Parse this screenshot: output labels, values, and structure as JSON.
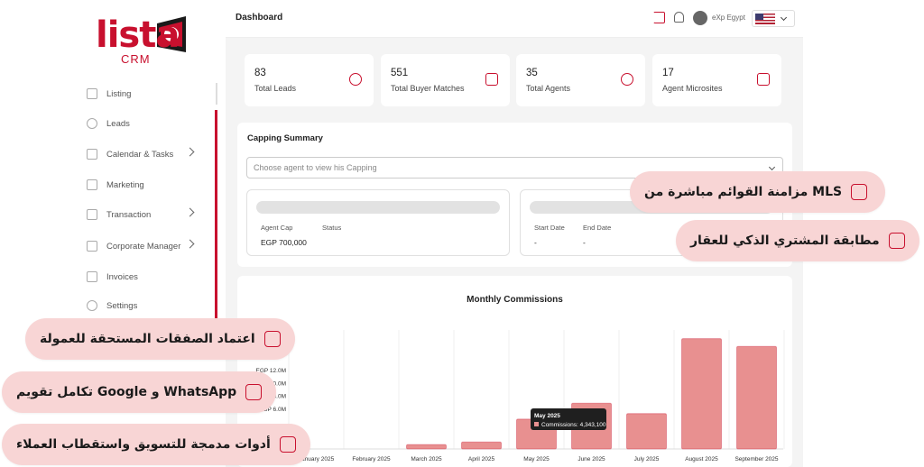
{
  "brand": {
    "logo_main": "lista",
    "logo_sub": "CRM"
  },
  "sidebar": {
    "items": [
      {
        "label": "Listing",
        "icon": "listing-icon",
        "has_children": false
      },
      {
        "label": "Leads",
        "icon": "users-icon",
        "has_children": false
      },
      {
        "label": "Calendar & Tasks",
        "icon": "calendar-icon",
        "has_children": true
      },
      {
        "label": "Marketing",
        "icon": "megaphone-icon",
        "has_children": false
      },
      {
        "label": "Transaction",
        "icon": "document-icon",
        "has_children": true
      },
      {
        "label": "Corporate Manager",
        "icon": "building-icon",
        "has_children": true
      },
      {
        "label": "Invoices",
        "icon": "invoice-icon",
        "has_children": false
      },
      {
        "label": "Settings",
        "icon": "gear-icon",
        "has_children": false
      }
    ]
  },
  "header": {
    "title": "Dashboard",
    "user_name": "eXp Egypt",
    "language": "en-US"
  },
  "stats": [
    {
      "value": "83",
      "label": "Total Leads",
      "icon": "network-icon"
    },
    {
      "value": "551",
      "label": "Total Buyer Matches",
      "icon": "briefcase-icon"
    },
    {
      "value": "35",
      "label": "Total Agents",
      "icon": "agent-icon"
    },
    {
      "value": "17",
      "label": "Agent Microsites",
      "icon": "profile-icon"
    }
  ],
  "capping": {
    "title": "Capping Summary",
    "placeholder": "Choose agent to view his Capping",
    "left": {
      "agent_cap_label": "Agent Cap",
      "status_label": "Status",
      "agent_cap_value": "EGP 700,000"
    },
    "right": {
      "start_label": "Start Date",
      "end_label": "End Date",
      "start_value": "-",
      "end_value": "-"
    }
  },
  "chart_data": {
    "type": "bar",
    "title": "Monthly Commissions",
    "categories": [
      "January 2025",
      "February 2025",
      "March 2025",
      "April 2025",
      "May 2025",
      "June 2025",
      "July 2025",
      "August 2025",
      "September 2025"
    ],
    "values": [
      0,
      0,
      400000,
      800000,
      4343100,
      6800000,
      5200000,
      16800000,
      15600000
    ],
    "ytick_labels": [
      "EGP 6.0M",
      "EGP 8.0M",
      "EGP 10.0M",
      "EGP 12.0M"
    ],
    "ytick_values": [
      6000000,
      8000000,
      10000000,
      12000000
    ],
    "bar_color": "#e89090",
    "tooltip": {
      "category": "May 2025",
      "text": "Commissions: 4,343,100"
    }
  },
  "overlays": [
    {
      "text": "مزامنة القوائم مباشرة من MLS",
      "icon": "sync-icon"
    },
    {
      "text": "مطابقة المشتري الذكي للعقار",
      "icon": "city-icon"
    },
    {
      "text": "اعتماد الصفقات المستحقة للعمولة",
      "icon": "approve-icon"
    },
    {
      "text": "تكامل تقويم Google و WhatsApp",
      "icon": "calendar-icon"
    },
    {
      "text": "أدوات مدمجة للتسويق واستقطاب العملاء",
      "icon": "megaphone-icon"
    }
  ],
  "colors": {
    "accent": "#c8102e",
    "overlay_bg": "#f8d5d5"
  }
}
